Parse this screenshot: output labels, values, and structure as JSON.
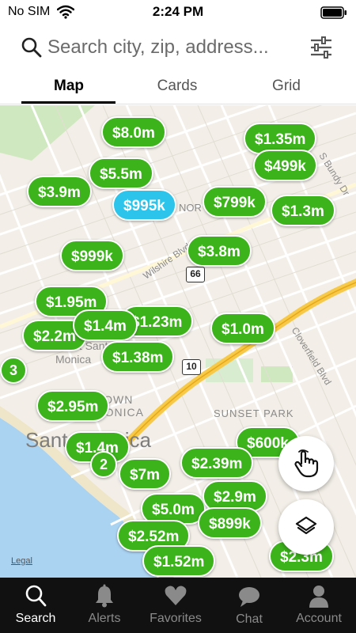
{
  "status_bar": {
    "carrier": "No SIM",
    "time": "2:24 PM"
  },
  "search": {
    "placeholder": "Search city, zip, address..."
  },
  "tabs": [
    {
      "label": "Map",
      "active": true
    },
    {
      "label": "Cards",
      "active": false
    },
    {
      "label": "Grid",
      "active": false
    }
  ],
  "map": {
    "labels": {
      "santa_monica_large": "Santa Monica",
      "port_santa_monica": "Port Santa",
      "port_santa_monica_2": "Monica",
      "downtown": "DOWN",
      "downtown_2": "MONICA",
      "sunset_park": "SUNSET PARK",
      "wilshire": "Wilshire Blvd",
      "cloverfield": "Cloverfield Blvd",
      "bundy": "S Bundy Dr",
      "northeast": "NOR",
      "road_10": "10",
      "road_66": "66",
      "legal": "Legal"
    },
    "pins": [
      {
        "price": "$8.0m",
        "color": "green"
      },
      {
        "price": "$1.35m",
        "color": "green"
      },
      {
        "price": "$5.5m",
        "color": "green"
      },
      {
        "price": "$499k",
        "color": "green"
      },
      {
        "price": "$3.9m",
        "color": "green"
      },
      {
        "price": "$995k",
        "color": "blue"
      },
      {
        "price": "$799k",
        "color": "green"
      },
      {
        "price": "$1.3m",
        "color": "green"
      },
      {
        "price": "$999k",
        "color": "green"
      },
      {
        "price": "$3.8m",
        "color": "green"
      },
      {
        "price": "$1.95m",
        "color": "green"
      },
      {
        "price": "$1.23m",
        "color": "green"
      },
      {
        "price": "$2.2m",
        "color": "green"
      },
      {
        "price": "$1.4m",
        "color": "green"
      },
      {
        "price": "$1.0m",
        "color": "green"
      },
      {
        "price": "$1.38m",
        "color": "green"
      },
      {
        "price": "$2.95m",
        "color": "green"
      },
      {
        "price": "$600k",
        "color": "green"
      },
      {
        "price": "$1.4m",
        "color": "green"
      },
      {
        "price": "$2.39m",
        "color": "green"
      },
      {
        "price": "$7m",
        "color": "green"
      },
      {
        "price": "$5.0m",
        "color": "green"
      },
      {
        "price": "$2.9m",
        "color": "green"
      },
      {
        "price": "$2.52m",
        "color": "green"
      },
      {
        "price": "$899k",
        "color": "green"
      },
      {
        "price": "$1.52m",
        "color": "green"
      },
      {
        "price": "$2.3m",
        "color": "green"
      }
    ],
    "clusters": [
      "3",
      "2"
    ]
  },
  "bottom_nav": [
    {
      "label": "Search",
      "icon": "search-icon",
      "active": true
    },
    {
      "label": "Alerts",
      "icon": "bell-icon",
      "active": false
    },
    {
      "label": "Favorites",
      "icon": "heart-icon",
      "active": false
    },
    {
      "label": "Chat",
      "icon": "chat-icon",
      "active": false
    },
    {
      "label": "Account",
      "icon": "person-icon",
      "active": false
    }
  ],
  "colors": {
    "pin_green": "#3cb21b",
    "pin_blue": "#2cc4ea",
    "nav_bg": "#111111"
  }
}
